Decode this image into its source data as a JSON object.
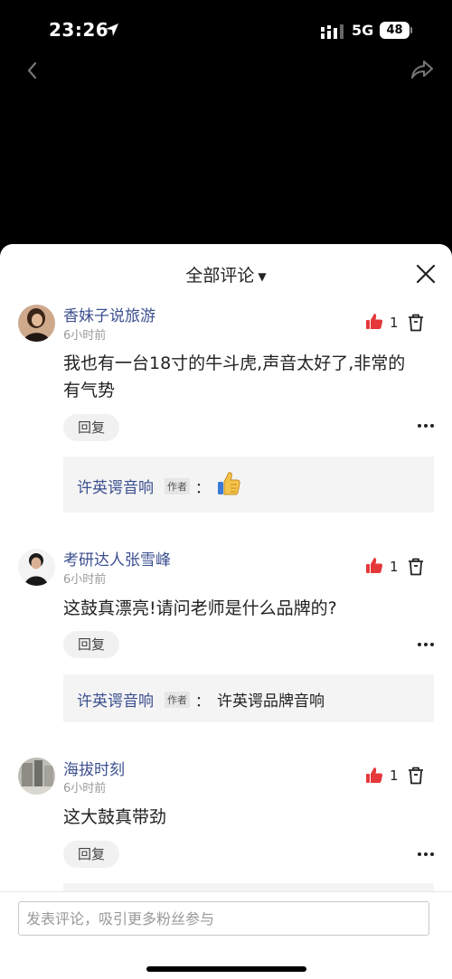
{
  "status": {
    "time": "23:26",
    "network": "5G",
    "battery": "48"
  },
  "sheet": {
    "title": "全部评论",
    "comments": [
      {
        "username": "香妹子说旅游",
        "time": "6小时前",
        "text_line1": "我也有一台18寸的牛斗虎,声音太好了,非常的",
        "text_line2": "有气势",
        "likes": "1",
        "reply_label": "回复",
        "reply": {
          "author": "许英谔音响",
          "tag": "作者",
          "colon": "：",
          "content": ""
        }
      },
      {
        "username": "考研达人张雪峰",
        "time": "6小时前",
        "text_line1": "这鼓真漂亮!请问老师是什么品牌的?",
        "likes": "1",
        "reply_label": "回复",
        "reply": {
          "author": "许英谔音响",
          "tag": "作者",
          "colon": "：",
          "content": "许英谔品牌音响"
        }
      },
      {
        "username": "海拔时刻",
        "time": "6小时前",
        "text_line1": "这大鼓真带劲",
        "likes": "1",
        "reply_label": "回复"
      }
    ]
  },
  "input": {
    "placeholder": "发表评论，吸引更多粉丝参与"
  }
}
